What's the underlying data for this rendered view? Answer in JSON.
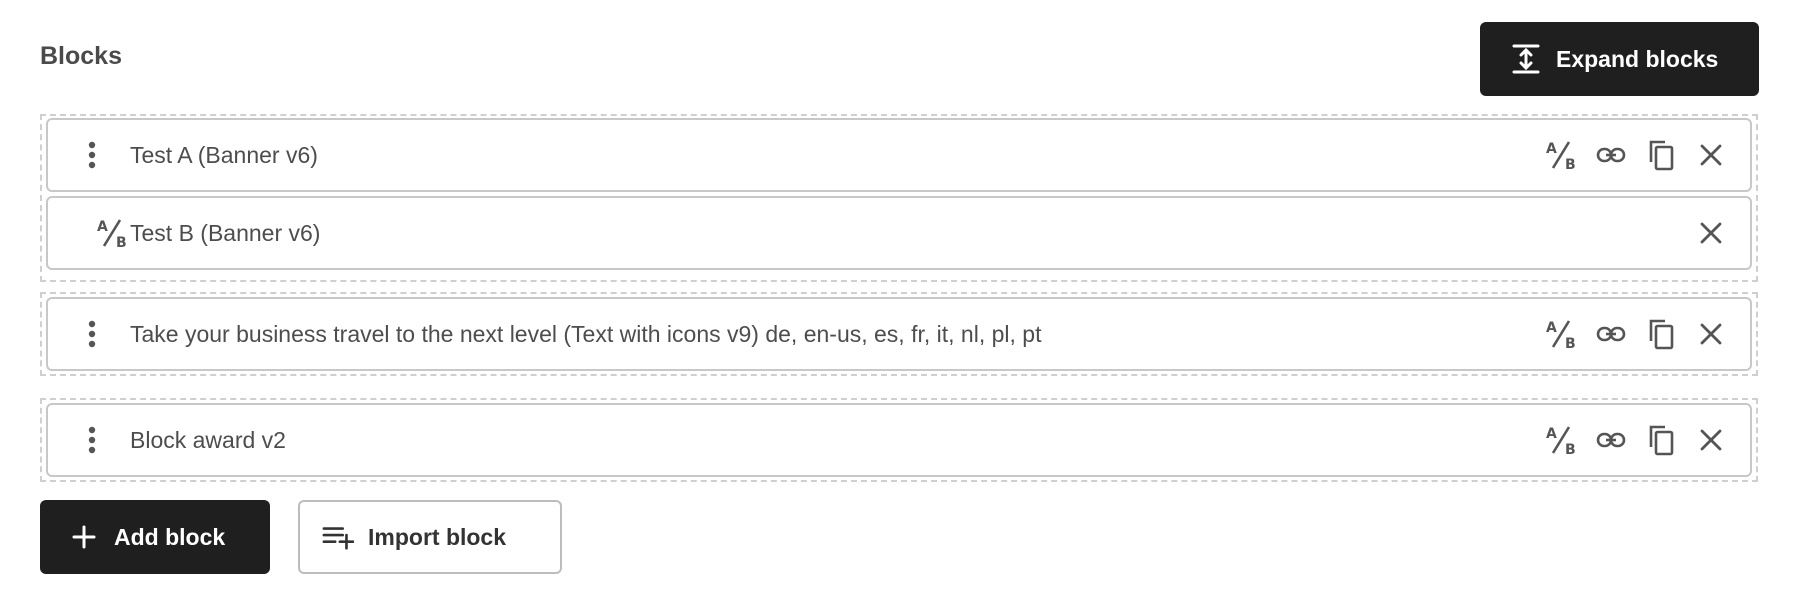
{
  "header": {
    "title": "Blocks",
    "expand_label": "Expand blocks"
  },
  "groups": [
    {
      "rows": [
        {
          "label": "Test A (Banner v6)"
        },
        {
          "label": "Test B (Banner v6)"
        }
      ]
    },
    {
      "rows": [
        {
          "label": "Take your business travel to the next level (Text with icons v9) de, en-us, es, fr, it, nl, pl, pt"
        }
      ]
    },
    {
      "rows": [
        {
          "label": "Block award v2"
        }
      ]
    }
  ],
  "footer": {
    "add_label": "Add block",
    "import_label": "Import block"
  },
  "icons": {
    "drag": "drag-handle-icon",
    "ab": "ab-test-icon",
    "link": "link-icon",
    "copy": "copy-icon",
    "close": "close-icon",
    "expand": "expand-vertical-icon",
    "plus": "plus-icon",
    "import": "playlist-add-icon"
  }
}
